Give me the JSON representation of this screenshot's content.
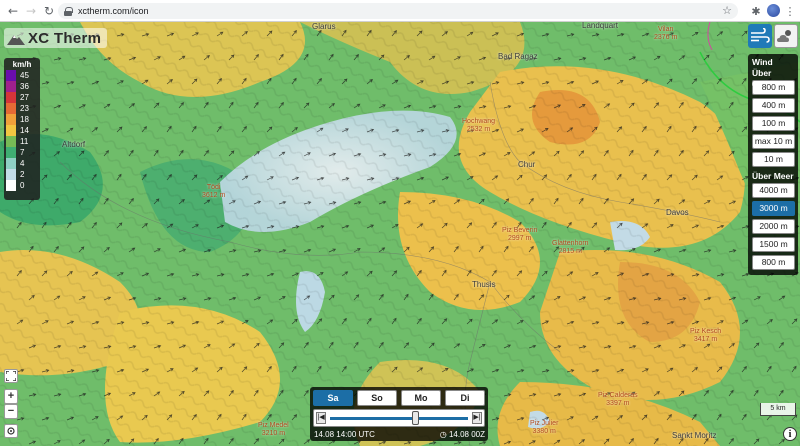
{
  "browser": {
    "back_icon": "arrow-left-icon",
    "forward_icon": "arrow-right-icon",
    "reload_icon": "reload-icon",
    "url": "xctherm.com/icon"
  },
  "app": {
    "logo_text": "XC Therm"
  },
  "legend": {
    "unit": "km/h",
    "entries": [
      {
        "value": "45",
        "color": "#6a0dad"
      },
      {
        "value": "36",
        "color": "#a0208c"
      },
      {
        "value": "27",
        "color": "#d6353a"
      },
      {
        "value": "23",
        "color": "#e56a35"
      },
      {
        "value": "18",
        "color": "#f0a13a"
      },
      {
        "value": "14",
        "color": "#f2c641"
      },
      {
        "value": "11",
        "color": "#76bb55"
      },
      {
        "value": "7",
        "color": "#3fae72"
      },
      {
        "value": "4",
        "color": "#8fd0c4"
      },
      {
        "value": "2",
        "color": "#c3dde8"
      },
      {
        "value": "0",
        "color": "#ffffff"
      }
    ]
  },
  "layers": {
    "wind_label": "Wind",
    "ground_label": "Über Grund",
    "ground_levels": [
      "800 m",
      "400 m",
      "100 m",
      "max 10 m",
      "10 m"
    ],
    "sea_label": "Über Meer",
    "sea_levels": [
      "4000 m",
      "3000 m",
      "2000 m",
      "1500 m",
      "800 m"
    ],
    "active_level": "3000 m"
  },
  "time": {
    "days": [
      "Sa",
      "So",
      "Mo",
      "Di"
    ],
    "active_day": "Sa",
    "slider_value": "14:00",
    "current": "14.08 14:00 UTC",
    "model_run": "14.08 00Z"
  },
  "map_labels": {
    "places": [
      "Glarus",
      "Altdorf",
      "Chur",
      "Thusis",
      "Davos",
      "Bad Ragaz",
      "Sankt Moritz",
      "Landquart"
    ],
    "peaks": [
      {
        "name": "Tödi",
        "elev": "3612 m"
      },
      {
        "name": "Hochwang",
        "elev": "2532 m"
      },
      {
        "name": "Piz Beverin",
        "elev": "2997 m"
      },
      {
        "name": "Piz Kesch",
        "elev": "3417 m"
      },
      {
        "name": "Piz Calderas",
        "elev": "3397 m"
      },
      {
        "name": "Piz Julier",
        "elev": "3380 m"
      },
      {
        "name": "Vilan",
        "elev": "2376 m"
      },
      {
        "name": "Glattenhorn",
        "elev": "2815 m"
      },
      {
        "name": "Piz Medel",
        "elev": "3210 m"
      }
    ]
  },
  "scale_label": "5 km",
  "colors": {
    "accent": "#1c6ea6",
    "panel_bg": "#000000"
  }
}
